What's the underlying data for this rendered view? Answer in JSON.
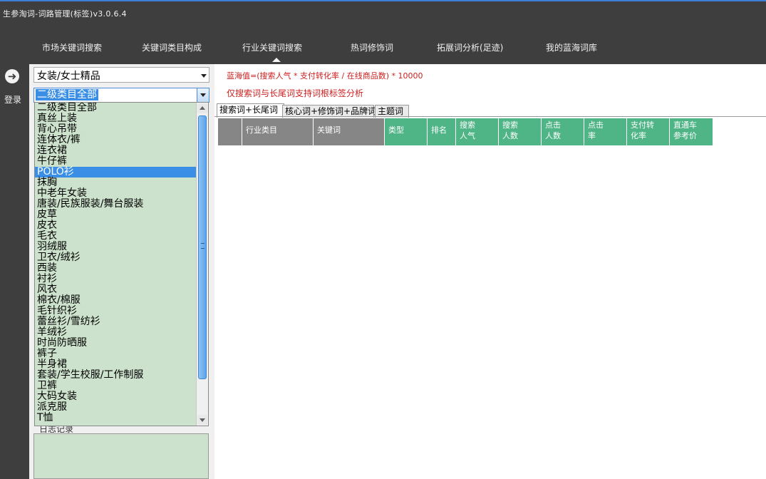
{
  "window": {
    "title": "生参淘词-词路管理(标签)v3.0.6.4"
  },
  "nav": {
    "items": [
      {
        "label": "市场关键词搜索"
      },
      {
        "label": "关键词类目构成"
      },
      {
        "label": "行业关键词搜索",
        "active": true
      },
      {
        "label": "热词修饰词"
      },
      {
        "label": "拓展词分析(足迹)"
      },
      {
        "label": "我的蓝海词库"
      }
    ]
  },
  "sidebar": {
    "login_label": "登录",
    "login_icon": "arrow-right-circle-icon"
  },
  "filters": {
    "category": "女装/女士精品",
    "subcategory": "二级类目全部",
    "log_label": "日志记录"
  },
  "dropdown": {
    "selected": "POLO衫",
    "items": [
      "二级类目全部",
      "真丝上装",
      "背心吊带",
      "连体衣/裤",
      "连衣裙",
      "牛仔裤",
      "POLO衫",
      "抹胸",
      "中老年女装",
      "唐装/民族服装/舞台服装",
      "皮草",
      "皮衣",
      "毛衣",
      "羽绒服",
      "卫衣/绒衫",
      "西装",
      "衬衫",
      "风衣",
      "棉衣/棉服",
      "毛针织衫",
      "蕾丝衫/雪纺衫",
      "羊绒衫",
      "时尚防晒服",
      "裤子",
      "半身裙",
      "套装/学生校服/工作制服",
      "卫裤",
      "大码女装",
      "派克服",
      "T恤"
    ]
  },
  "main": {
    "formula": "蓝海值=(搜索人气 * 支付转化率 / 在线商品数) * 10000",
    "note": "仅搜索词与长尾词支持词根标签分析",
    "tabs": [
      "搜索词+长尾词",
      "核心词+修饰词+品牌词",
      "主题词"
    ],
    "columns": [
      {
        "l1": "",
        "l2": ""
      },
      {
        "l1": "行业类目",
        "l2": ""
      },
      {
        "l1": "关键词",
        "l2": ""
      },
      {
        "l1": "类型",
        "l2": ""
      },
      {
        "l1": "排名",
        "l2": ""
      },
      {
        "l1": "搜索",
        "l2": "人气"
      },
      {
        "l1": "搜索",
        "l2": "人数"
      },
      {
        "l1": "点击",
        "l2": "人数"
      },
      {
        "l1": "点击",
        "l2": "率"
      },
      {
        "l1": "支付转",
        "l2": "化率"
      },
      {
        "l1": "直通车",
        "l2": "参考价"
      }
    ]
  },
  "colors": {
    "gray_header": "#868686",
    "green_header": "#4fb486",
    "highlight": "#3a8ee6",
    "list_bg": "#cde2cc",
    "warning_text": "#cc1f1f"
  }
}
